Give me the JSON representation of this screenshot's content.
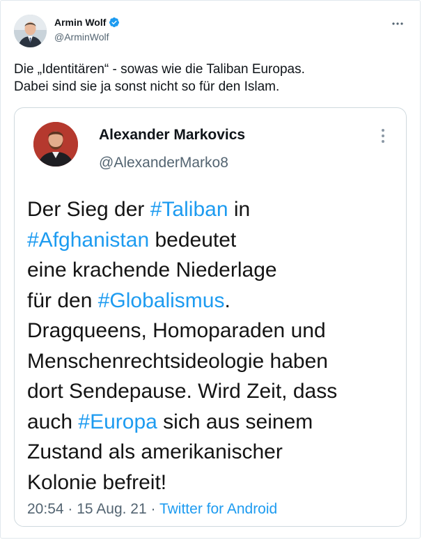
{
  "tweet": {
    "author": {
      "name": "Armin Wolf",
      "handle": "@ArminWolf",
      "verified": true,
      "avatar_icon": "profile-photo-man-suit"
    },
    "more_icon": "more-horizontal-icon",
    "text_line1": "Die „Identitären“ - sowas wie die Taliban Europas.",
    "text_line2": "Dabei sind sie ja sonst nicht so für den Islam."
  },
  "quoted_tweet": {
    "author": {
      "name": "Alexander Markovics",
      "handle": "@AlexanderMarko8",
      "avatar_icon": "profile-photo-bearded-man"
    },
    "more_icon": "more-vertical-icon",
    "text": {
      "t1": "Der Sieg der ",
      "h1": "#Taliban",
      "t2": " in",
      "h2": "#Afghanistan",
      "t3": " bedeutet",
      "t4": "eine krachende Niederlage",
      "t5": "für den ",
      "h3": "#Globalismus",
      "t6": ".",
      "t7": "Dragqueens, Homoparaden und",
      "t8": "Menschenrechtsideologie haben",
      "t9": "dort Sendepause. Wird Zeit, dass",
      "t10": "auch ",
      "h4": "#Europa",
      "t11": " sich aus seinem",
      "t12": "Zustand als amerikanischer",
      "t13": "Kolonie befreit!"
    },
    "footer": {
      "time": "20:54",
      "sep1": " · ",
      "date": "15 Aug. 21",
      "sep2": " · ",
      "source": "Twitter for Android"
    }
  },
  "colors": {
    "link": "#1d9bf0",
    "secondary_text": "#536471",
    "border": "#cfd9de",
    "verified_badge": "#1d9bf0"
  }
}
